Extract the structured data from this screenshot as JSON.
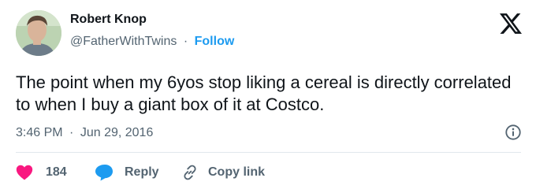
{
  "tweet": {
    "author_name": "Robert Knop",
    "handle": "@FatherWithTwins",
    "separator": "·",
    "follow_label": "Follow",
    "text": "The point when my 6yos stop liking a cereal is directly correlated to when I buy a giant box of it at Costco.",
    "time": "3:46 PM",
    "date": "Jun 29, 2016"
  },
  "actions": {
    "like_count": "184",
    "reply_label": "Reply",
    "copy_label": "Copy link"
  },
  "icons": {
    "avatar": "avatar-photo",
    "logo": "x-logo-icon",
    "info": "info-icon",
    "like": "heart-icon",
    "reply": "speech-bubble-icon",
    "copy": "link-icon"
  },
  "colors": {
    "link": "#1d9bf0",
    "like": "#f91880",
    "reply": "#1d9bf0",
    "secondary_text": "#536471",
    "primary_text": "#0f1419"
  }
}
